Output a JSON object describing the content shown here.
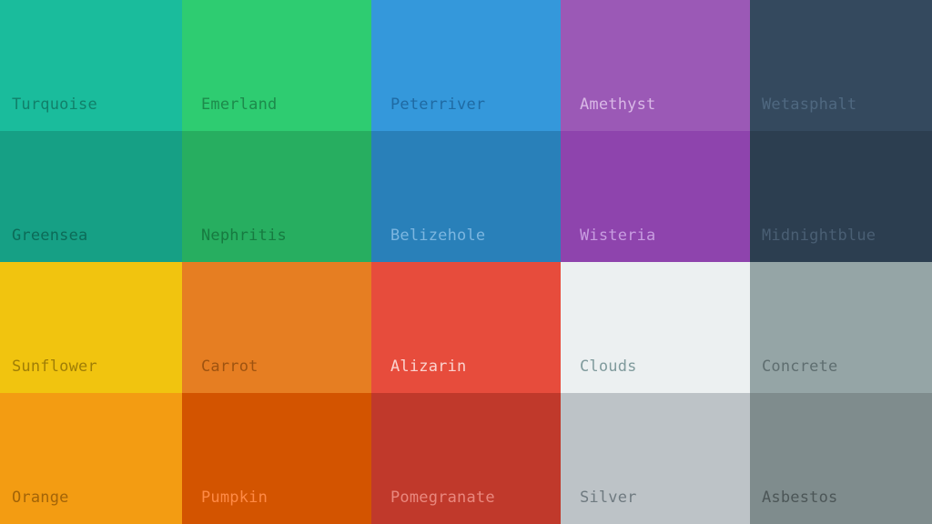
{
  "swatches": [
    {
      "name": "Turquoise",
      "color": "#1abc9c",
      "text_color": "#11806a"
    },
    {
      "name": "Emerland",
      "color": "#2ecc71",
      "text_color": "#1d8a4b"
    },
    {
      "name": "Peterriver",
      "color": "#3498db",
      "text_color": "#1f6aa3"
    },
    {
      "name": "Amethyst",
      "color": "#9b59b6",
      "text_color": "#d9b8e6"
    },
    {
      "name": "Wetasphalt",
      "color": "#34495e",
      "text_color": "#4f6880"
    },
    {
      "name": "Greensea",
      "color": "#16a085",
      "text_color": "#0c6b58"
    },
    {
      "name": "Nephritis",
      "color": "#27ae60",
      "text_color": "#177a40"
    },
    {
      "name": "Belizehole",
      "color": "#2980b9",
      "text_color": "#7cb6e0"
    },
    {
      "name": "Wisteria",
      "color": "#8e44ad",
      "text_color": "#c89de0"
    },
    {
      "name": "Midnightblue",
      "color": "#2c3e50",
      "text_color": "#4a5f74"
    },
    {
      "name": "Sunflower",
      "color": "#f1c40f",
      "text_color": "#a07e06"
    },
    {
      "name": "Carrot",
      "color": "#e67e22",
      "text_color": "#9e5310"
    },
    {
      "name": "Alizarin",
      "color": "#e74c3c",
      "text_color": "#fbd3cf"
    },
    {
      "name": "Clouds",
      "color": "#ecf0f1",
      "text_color": "#7f9a9c"
    },
    {
      "name": "Concrete",
      "color": "#95a5a6",
      "text_color": "#5f6e70"
    },
    {
      "name": "Orange",
      "color": "#f39c12",
      "text_color": "#a36408"
    },
    {
      "name": "Pumpkin",
      "color": "#d35400",
      "text_color": "#ff8a45"
    },
    {
      "name": "Pomegranate",
      "color": "#c0392b",
      "text_color": "#e9887e"
    },
    {
      "name": "Silver",
      "color": "#bdc3c7",
      "text_color": "#6f7a80"
    },
    {
      "name": "Asbestos",
      "color": "#7f8c8d",
      "text_color": "#4c5657"
    }
  ]
}
